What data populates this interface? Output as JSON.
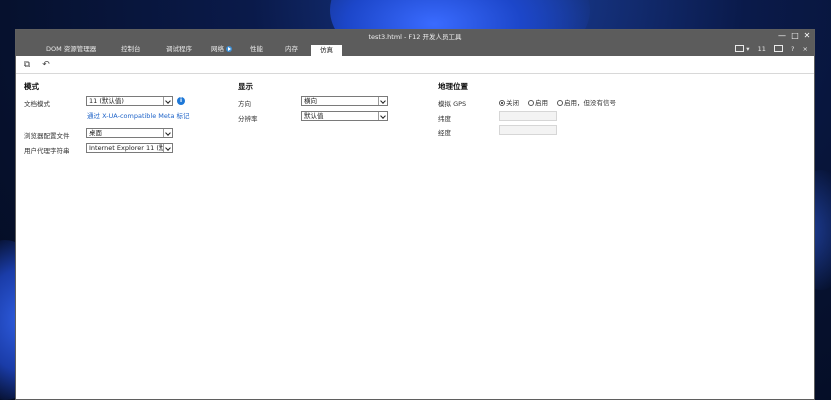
{
  "window": {
    "title": "test3.html - F12 开发人员工具",
    "controls": {
      "minimize": "—",
      "maximize": "□",
      "close": "✕"
    }
  },
  "tabs": [
    {
      "label": "DOM 资源管理器"
    },
    {
      "label": "控制台"
    },
    {
      "label": "调试程序"
    },
    {
      "label": "网络"
    },
    {
      "label": "性能"
    },
    {
      "label": "内存"
    },
    {
      "label": "仿真",
      "active": true
    }
  ],
  "right_tools": {
    "device_label": "11",
    "pin_icon": "?",
    "help_icon": "?",
    "close_icon": "×"
  },
  "mode": {
    "title": "模式",
    "doc_mode_label": "文档模式",
    "doc_mode_value": "11 (默认值)",
    "meta_link": "通过 X-UA-compatible Meta 标记",
    "browser_profile_label": "浏览器配置文件",
    "browser_profile_value": "桌面",
    "user_agent_label": "用户代理字符串",
    "user_agent_value": "Internet Explorer 11 (默"
  },
  "display": {
    "title": "显示",
    "orientation_label": "方向",
    "orientation_value": "横向",
    "resolution_label": "分辨率",
    "resolution_value": "默认值"
  },
  "geo": {
    "title": "地理位置",
    "gps_label": "模拟 GPS",
    "options": [
      "关闭",
      "启用",
      "启用，但没有信号"
    ],
    "selected": 0,
    "latitude_label": "纬度",
    "longitude_label": "经度"
  },
  "icons": [
    "select-element-icon",
    "undo-icon",
    "info-icon",
    "screen-icon",
    "dock-icon",
    "help-icon",
    "close-icon"
  ]
}
